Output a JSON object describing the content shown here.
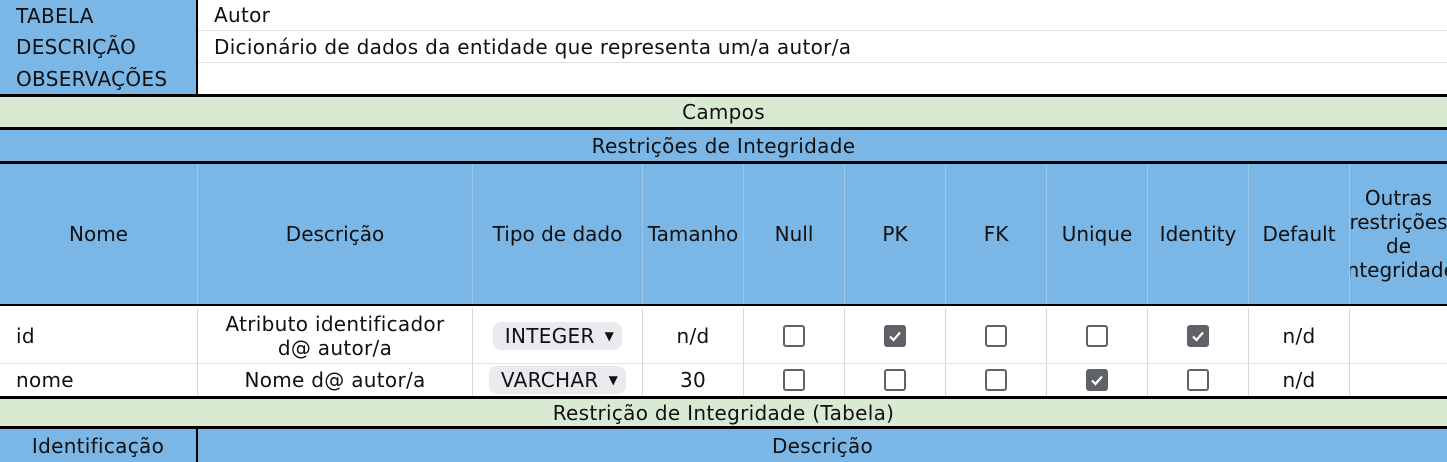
{
  "meta_rows": [
    {
      "label": "TABELA",
      "value": "Autor"
    },
    {
      "label": "DESCRIÇÃO",
      "value": "Dicionário de dados da entidade que representa um/a autor/a"
    },
    {
      "label": "OBSERVAÇÕES",
      "value": ""
    }
  ],
  "sections": {
    "campos": "Campos",
    "restricoes": "Restrições de Integridade",
    "restricao_tabela": "Restrição de Integridade (Tabela)"
  },
  "columns": {
    "nome": "Nome",
    "descricao": "Descrição",
    "tipo": "Tipo de dado",
    "tamanho": "Tamanho",
    "null": "Null",
    "pk": "PK",
    "fk": "FK",
    "unique": "Unique",
    "identity": "Identity",
    "default": "Default",
    "outras": "Outras restrições de integridade"
  },
  "fields": [
    {
      "nome": "id",
      "descricao": "Atributo identificador d@ autor/a",
      "tipo": "INTEGER",
      "tamanho": "n/d",
      "null": false,
      "pk": true,
      "fk": false,
      "unique": false,
      "identity": true,
      "default": "n/d",
      "outras": ""
    },
    {
      "nome": "nome",
      "descricao": "Nome d@ autor/a",
      "tipo": "VARCHAR",
      "tamanho": "30",
      "null": false,
      "pk": false,
      "fk": false,
      "unique": true,
      "identity": false,
      "default": "n/d",
      "outras": ""
    }
  ],
  "table_constraint_headers": {
    "identificacao": "Identificação",
    "descricao": "Descrição"
  },
  "colors": {
    "header_blue": "#7ab6e6",
    "section_green": "#d9ead3",
    "checkbox_gray": "#5f6368",
    "chip_gray": "#e8eaed"
  },
  "icons": {
    "dropdown": "triangle-down-icon",
    "checkbox_checked": "check-icon"
  }
}
